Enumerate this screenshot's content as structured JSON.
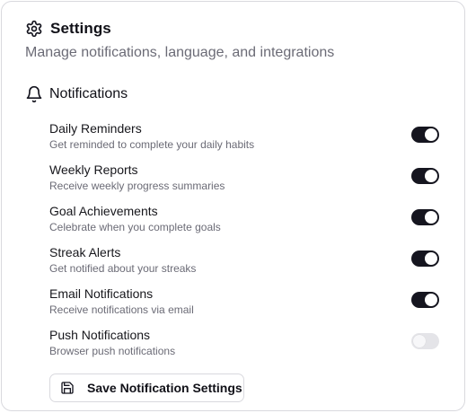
{
  "header": {
    "title": "Settings",
    "subtitle": "Manage notifications, language, and integrations",
    "icon": "gear-icon"
  },
  "notifications": {
    "title": "Notifications",
    "icon": "bell-icon",
    "items": [
      {
        "label": "Daily Reminders",
        "description": "Get reminded to complete your daily habits",
        "enabled": true
      },
      {
        "label": "Weekly Reports",
        "description": "Receive weekly progress summaries",
        "enabled": true
      },
      {
        "label": "Goal Achievements",
        "description": "Celebrate when you complete goals",
        "enabled": true
      },
      {
        "label": "Streak Alerts",
        "description": "Get notified about your streaks",
        "enabled": true
      },
      {
        "label": "Email Notifications",
        "description": "Receive notifications via email",
        "enabled": true
      },
      {
        "label": "Push Notifications",
        "description": "Browser push notifications",
        "enabled": false
      }
    ]
  },
  "save_button": {
    "label": "Save Notification Settings",
    "icon": "save-icon"
  },
  "colors": {
    "toggle_on": "#15151f",
    "toggle_off": "#e4e4e8",
    "muted_text": "#6b6b76"
  }
}
